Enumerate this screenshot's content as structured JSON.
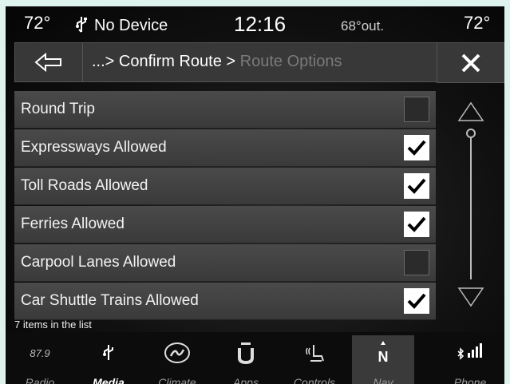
{
  "status": {
    "temp_left": "72°",
    "device": "No Device",
    "clock": "12:16",
    "outside_temp": "68°out.",
    "temp_right": "72°"
  },
  "header": {
    "breadcrumb_prefix": "...> Confirm Route > ",
    "breadcrumb_current": "Route Options"
  },
  "options": [
    {
      "label": "Round Trip",
      "checked": false
    },
    {
      "label": "Expressways Allowed",
      "checked": true
    },
    {
      "label": "Toll Roads Allowed",
      "checked": true
    },
    {
      "label": "Ferries Allowed",
      "checked": true
    },
    {
      "label": "Carpool Lanes Allowed",
      "checked": false
    },
    {
      "label": "Car Shuttle Trains Allowed",
      "checked": true
    }
  ],
  "list_count": "7 items in the list",
  "nav": {
    "radio_freq": "87.9",
    "radio": "Radio",
    "media": "Media",
    "climate": "Climate",
    "apps": "Apps",
    "controls": "Controls",
    "nav": "Nav",
    "phone": "Phone"
  }
}
